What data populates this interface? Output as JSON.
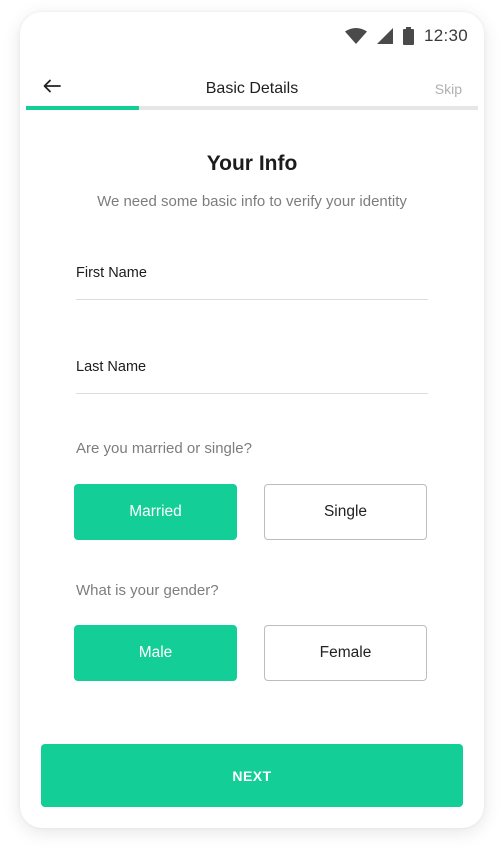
{
  "status_bar": {
    "time": "12:30",
    "icons": [
      "wifi-icon",
      "cellular-signal-icon",
      "battery-icon"
    ]
  },
  "app_bar": {
    "title": "Basic Details",
    "back_icon": "arrow-left-icon",
    "skip_label": "Skip"
  },
  "progress": {
    "fraction": 0.25
  },
  "form": {
    "heading": "Your Info",
    "subheading": "We need some basic info to verify your identity",
    "first_name": {
      "placeholder": "First Name",
      "value": ""
    },
    "last_name": {
      "placeholder": "Last Name",
      "value": ""
    },
    "marital_question": "Are you married or single?",
    "marital_options": [
      {
        "label": "Married",
        "selected": true
      },
      {
        "label": "Single",
        "selected": false
      }
    ],
    "gender_question": "What is your gender?",
    "gender_options": [
      {
        "label": "Male",
        "selected": true
      },
      {
        "label": "Female",
        "selected": false
      }
    ]
  },
  "next_button": {
    "label": "NEXT"
  },
  "colors": {
    "accent": "#13ce96",
    "progress_track": "#e6e6e6",
    "muted_text": "#7d7d7d",
    "skip_text": "#b0b0b0"
  }
}
